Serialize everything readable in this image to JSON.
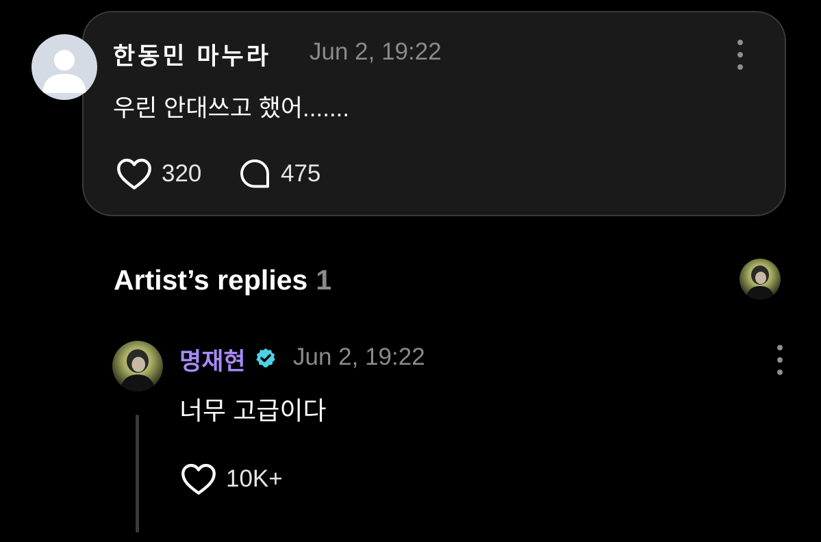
{
  "comment": {
    "author": "한동민 마누라",
    "time": "Jun 2, 19:22",
    "text": "우린 안대쓰고 했어.......",
    "likes": "320",
    "replies": "475"
  },
  "artist_replies": {
    "title": "Artist’s replies",
    "count": "1"
  },
  "reply": {
    "author": "명재현",
    "time": "Jun 2, 19:22",
    "text": "너무 고급이다",
    "likes": "10K+"
  },
  "colors": {
    "background": "#000000",
    "card": "#1a1a1a",
    "artist_name": "#a78bfa",
    "verified_badge": "#4fd1e5",
    "muted_text": "#8a8a8a"
  },
  "icons": {
    "default_avatar": "user-silhouette-icon",
    "like": "heart-outline-icon",
    "reply": "speech-bubble-icon",
    "more": "kebab-menu-icon",
    "verified": "verified-badge-icon"
  }
}
